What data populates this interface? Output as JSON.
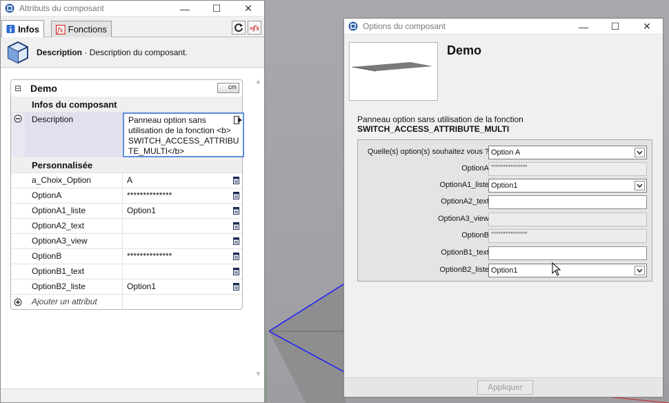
{
  "left_window": {
    "title": "Attributs du composant",
    "tabs": [
      {
        "label": "Infos"
      },
      {
        "label": "Fonctions"
      }
    ],
    "description_bar": {
      "label": "Description",
      "sep": " · ",
      "text": "Description du composant."
    },
    "component": {
      "name": "Demo",
      "unit": "cm",
      "sections": {
        "infos": "Infos du composant",
        "custom": "Personnalisée"
      },
      "description": {
        "key": "Description",
        "value": "Panneau option sans utilisation de la fonction <b> SWITCH_ACCESS_ATTRIBU TE_MULTI</b>"
      },
      "rows": [
        {
          "key": "a_Choix_Option",
          "value": "A"
        },
        {
          "key": "OptionA",
          "value": "**************"
        },
        {
          "key": "OptionA1_liste",
          "value": "Option1"
        },
        {
          "key": "OptionA2_text",
          "value": ""
        },
        {
          "key": "OptionA3_view",
          "value": ""
        },
        {
          "key": "OptionB",
          "value": "**************"
        },
        {
          "key": "OptionB1_text",
          "value": ""
        },
        {
          "key": "OptionB2_liste",
          "value": "Option1"
        }
      ],
      "add_attribute": "Ajouter un attribut"
    }
  },
  "right_window": {
    "title": "Options du composant",
    "component_name": "Demo",
    "description_line1": "Panneau option sans utilisation de la fonction",
    "description_line2": "SWITCH_ACCESS_ATTRIBUTE_MULTI",
    "fields": [
      {
        "label": "Quelle(s) option(s) souhaitez vous ?",
        "type": "select",
        "value": "Option A"
      },
      {
        "label": "OptionA",
        "type": "readonly",
        "value": "***************"
      },
      {
        "label": "OptionA1_liste",
        "type": "select",
        "value": "Option1"
      },
      {
        "label": "OptionA2_text",
        "type": "text",
        "value": ""
      },
      {
        "label": "OptionA3_view",
        "type": "readonly",
        "value": ""
      },
      {
        "label": "OptionB",
        "type": "readonly",
        "value": "***************"
      },
      {
        "label": "OptionB1_text",
        "type": "text",
        "value": ""
      },
      {
        "label": "OptionB2_liste",
        "type": "select",
        "value": "Option1"
      }
    ],
    "apply_label": "Appliquer"
  },
  "colors": {
    "accent_blue": "#5b8edc",
    "viewport": "#a0a0a4",
    "axis_blue": "#1a1aff"
  }
}
